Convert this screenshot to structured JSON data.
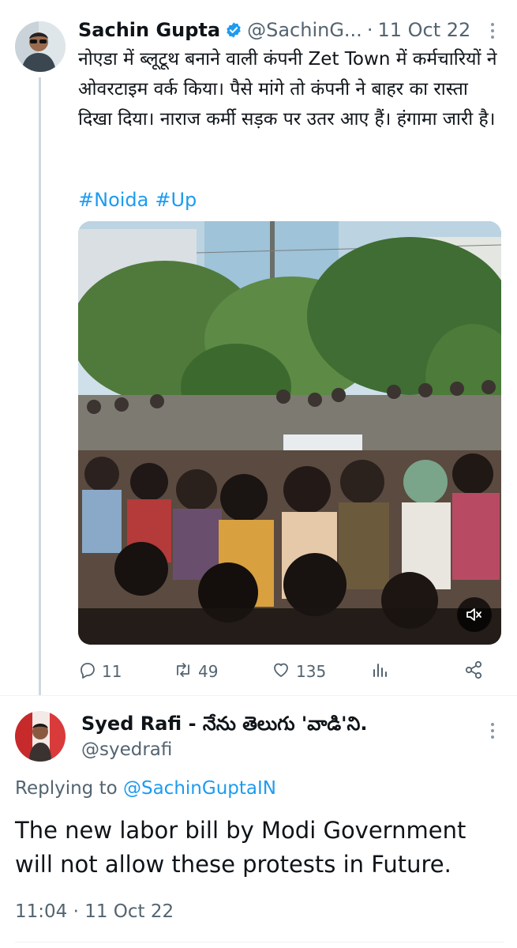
{
  "tweet": {
    "author_name": "Sachin Gupta",
    "handle": "@SachinG...",
    "separator": "·",
    "date": "11 Oct 22",
    "text": "नोएडा में ब्लूटूथ बनाने वाली कंपनी Zet Town में कर्मचारियों ने ओवरटाइम वर्क किया। पैसे मांगे तो कंपनी ने बाहर का रास्ता दिखा दिया। नाराज कर्मी सड़क पर उतर आए हैं। हंगामा जारी है।",
    "hashtags": [
      "#Noida",
      "#Up"
    ],
    "stats": {
      "replies": "11",
      "retweets": "49",
      "likes": "135"
    }
  },
  "reply": {
    "author_name": "Syed Rafi - నేను తెలుగు 'వాడి'ని.",
    "handle": "@syedrafi",
    "replying_prefix": "Replying to",
    "replying_to": "@SachinGuptaIN",
    "text": "The new labor bill by Modi Government will not allow these protests in Future.",
    "time": "11:04",
    "separator": "·",
    "date": "11 Oct 22"
  },
  "icons": {
    "verified": "verified-badge-icon",
    "more": "more-icon",
    "reply": "reply-icon",
    "retweet": "retweet-icon",
    "like": "heart-icon",
    "views": "views-icon",
    "share": "share-icon",
    "mute": "speaker-muted-icon"
  },
  "colors": {
    "accent": "#1d9bf0",
    "text": "#0f1419",
    "secondary": "#536471"
  }
}
